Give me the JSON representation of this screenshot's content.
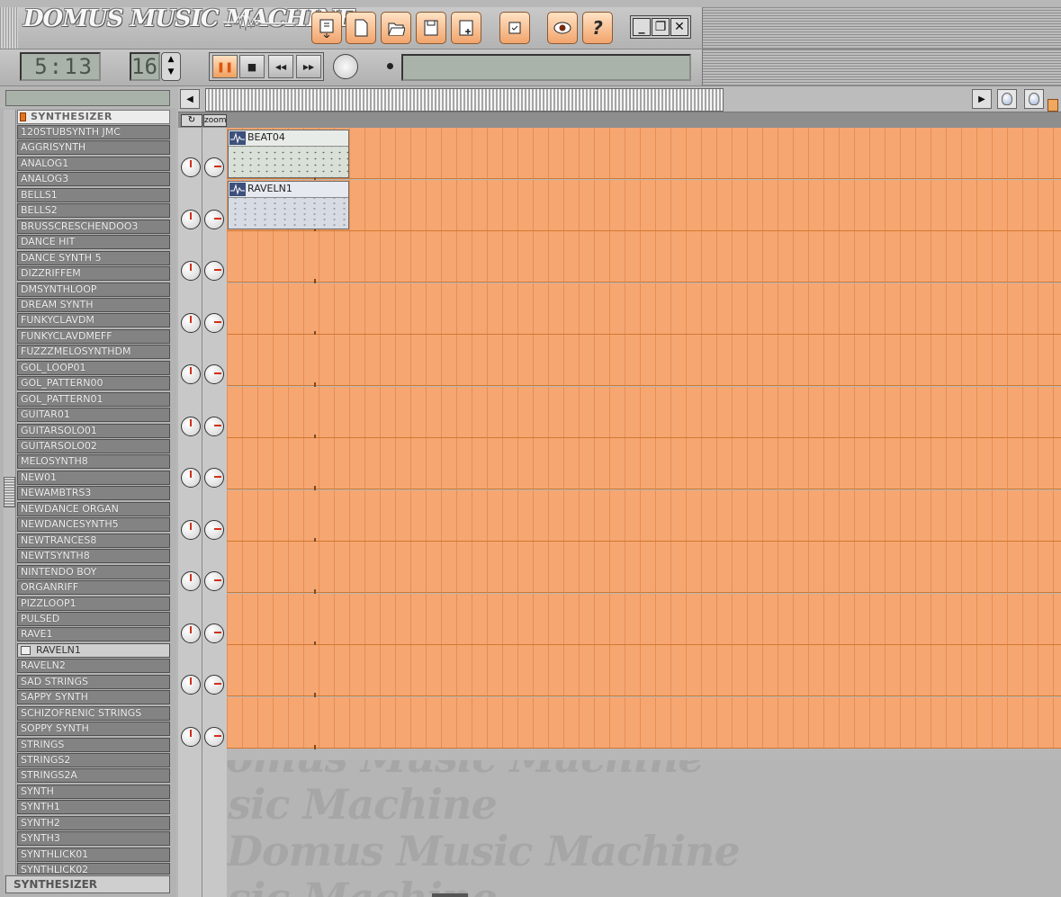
{
  "app": {
    "title": "DOMUS MUSIC MACHINE"
  },
  "toolbar": {
    "buttons": [
      {
        "name": "download-button",
        "icon": "download-icon"
      },
      {
        "name": "new-file-button",
        "icon": "new-file-icon"
      },
      {
        "name": "open-folder-button",
        "icon": "folder-open-icon"
      },
      {
        "name": "save-button",
        "icon": "save-icon"
      },
      {
        "name": "save-as-button",
        "icon": "save-as-icon"
      },
      {
        "name": "checkbox-button",
        "icon": "checkbox-icon"
      },
      {
        "name": "view-button",
        "icon": "eye-icon"
      },
      {
        "name": "help-button",
        "icon": "help-icon",
        "label": "?"
      }
    ],
    "window_controls": {
      "minimize": "_",
      "restore": "❐",
      "close": "✕"
    }
  },
  "transport": {
    "time": "5:13",
    "bpm": "16",
    "buttons": {
      "pause": "❚❚",
      "stop": "■",
      "rewind": "◀◀",
      "forward": "▶▶"
    },
    "status_text": ""
  },
  "library": {
    "category": "SYNTHESIZER",
    "items": [
      "120STUBSYNTH JMC",
      "AGGRISYNTH",
      "ANALOG1",
      "ANALOG3",
      "BELLS1",
      "BELLS2",
      "BRUSSCRESCHENDOO3",
      "DANCE HIT",
      "DANCE SYNTH 5",
      "DIZZRIFFEM",
      "DMSYNTHLOOP",
      "DREAM SYNTH",
      "FUNKYCLAVDM",
      "FUNKYCLAVDMEFF",
      "FUZZZMELOSYNTHDM",
      "GOL_LOOP01",
      "GOL_PATTERN00",
      "GOL_PATTERN01",
      "GUITAR01",
      "GUITARSOLO01",
      "GUITARSOLO02",
      "MELOSYNTH8",
      "NEW01",
      "NEWAMBTRS3",
      "NEWDANCE ORGAN",
      "NEWDANCESYNTH5",
      "NEWTRANCES8",
      "NEWTSYNTH8",
      "NINTENDO BOY",
      "ORGANRIFF",
      "PIZZLOOP1",
      "PULSED",
      "RAVE1",
      "RAVELN1",
      "RAVELN2",
      "SAD STRINGS",
      "SAPPY SYNTH",
      "SCHIZOFRENIC STRINGS",
      "SOPPY SYNTH",
      "STRINGS",
      "STRINGS2",
      "STRINGS2A",
      "SYNTH",
      "SYNTH1",
      "SYNTH2",
      "SYNTH3",
      "SYNTHLICK01",
      "SYNTHLICK02"
    ],
    "selected_item": "RAVELN1",
    "footer": "SYNTHESIZER"
  },
  "arranger": {
    "ruler": {
      "loop_icon": "loop-icon",
      "zoom_label": "zoom"
    },
    "track_count": 12,
    "clips": [
      {
        "name": "BEAT04",
        "track": 1
      },
      {
        "name": "RAVELN1",
        "track": 2
      }
    ],
    "watermark_text": "Domus Music Machine"
  },
  "colors": {
    "track_orange": "#f6a671",
    "accent_orange": "#f0a060",
    "lcd_green": "#a9b3a9"
  }
}
